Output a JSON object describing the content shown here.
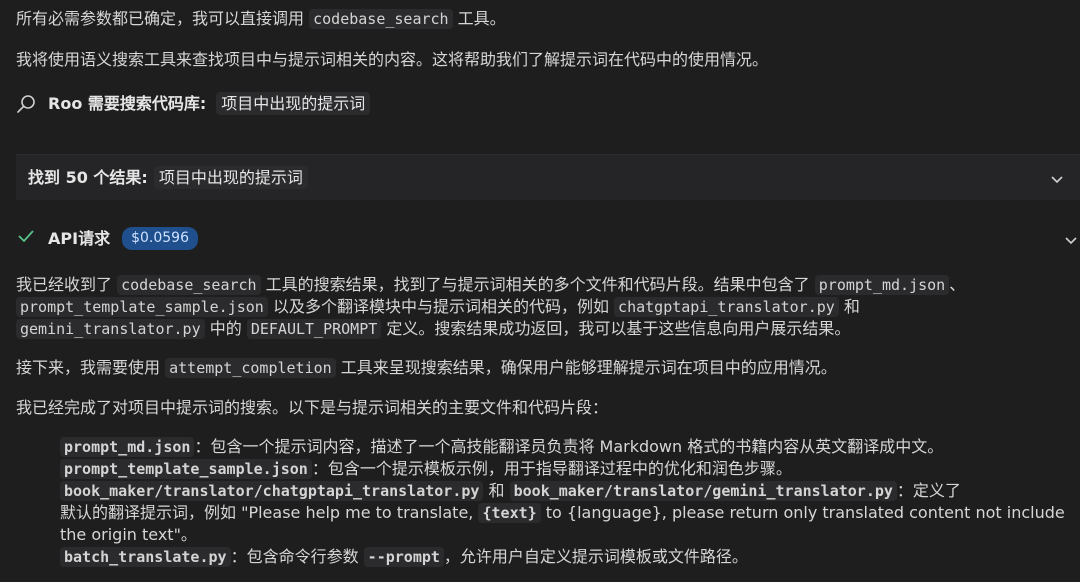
{
  "msg1": {
    "before": "所有必需参数都已确定，我可以直接调用",
    "code": "codebase_search",
    "after": "工具。"
  },
  "msg2": "我将使用语义搜索工具来查找项目中与提示词相关的内容。这将帮助我们了解提示词在代码中的使用情况。",
  "tool": {
    "label": "Roo 需要搜索代码库:",
    "query": "项目中出现的提示词"
  },
  "result": {
    "label": "找到 50 个结果:",
    "query": "项目中出现的提示词"
  },
  "api": {
    "label": "API请求",
    "cost": "$0.0596"
  },
  "para1": {
    "t1": "我已经收到了",
    "c1": "codebase_search",
    "t2": "工具的搜索结果，找到了与提示词相关的多个文件和代码片段。结果中包含了",
    "c2": "prompt_md.json",
    "t3": "、",
    "c3": "prompt_template_sample.json",
    "t4": "以及多个翻译模块中与提示词相关的代码，例如",
    "c4": "chatgptapi_translator.py",
    "t5": "和",
    "c5": "gemini_translator.py",
    "t6": "中的",
    "c6": "DEFAULT_PROMPT",
    "t7": "定义。搜索结果成功返回，我可以基于这些信息向用户展示结果。"
  },
  "para2": {
    "t1": "接下来，我需要使用",
    "c1": "attempt_completion",
    "t2": "工具来呈现搜索结果，确保用户能够理解提示词在项目中的应用情况。"
  },
  "para3": "我已经完成了对项目中提示词的搜索。以下是与提示词相关的主要文件和代码片段：",
  "items": [
    {
      "c1": "prompt_md.json",
      "t1": "：包含一个提示词内容，描述了一个高技能翻译员负责将 Markdown 格式的书籍内容从英文翻译成中文。"
    },
    {
      "c1": "prompt_template_sample.json",
      "t1": "：包含一个提示模板示例，用于指导翻译过程中的优化和润色步骤。"
    },
    {
      "c1": "book_maker/translator/chatgptapi_translator.py",
      "t1": "和",
      "c2": "book_maker/translator/gemini_translator.py",
      "t2": "：定义了",
      "t3": "默认的翻译提示词，例如 \"Please help me to translate,",
      "c3": "{text}",
      "t4": "to {language}, please return only translated content not include",
      "t5": "the origin text\"。"
    },
    {
      "c1": "batch_translate.py",
      "t1": "：包含命令行参数",
      "c2": "--prompt",
      "t2": "，允许用户自定义提示词模板或文件路径。"
    }
  ]
}
